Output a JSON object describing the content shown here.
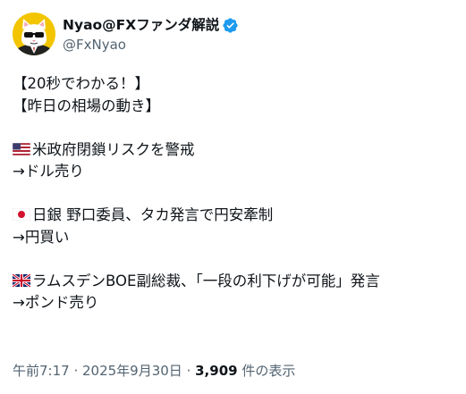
{
  "author": {
    "display_name": "Nyao@FXファンダ解説",
    "handle": "@FxNyao",
    "verified": true,
    "verified_color": "#1d9bf0"
  },
  "tweet": {
    "lines": {
      "l1": "【20秒でわかる！】",
      "l2": "【昨日の相場の動き】",
      "l3": "米政府閉鎖リスクを警戒",
      "l4": "→ドル売り",
      "l5": "日銀 野口委員、タカ発言で円安牽制",
      "l6": "→円買い",
      "l7": "ラムスデンBOE副総裁、「一段の利下げが可能」発言",
      "l8": "→ポンド売り"
    },
    "flags": [
      "us-flag",
      "jp-flag",
      "uk-flag"
    ]
  },
  "meta": {
    "time": "午前7:17",
    "separator1": " · ",
    "date": "2025年9月30日",
    "separator2": " · ",
    "views_count": "3,909",
    "views_label": " 件の表示"
  }
}
